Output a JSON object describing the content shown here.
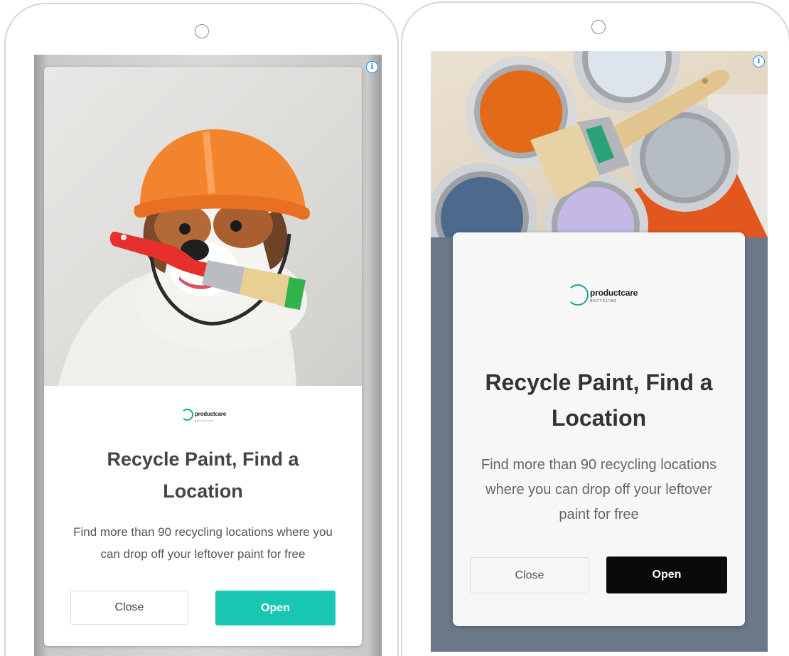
{
  "ads": [
    {
      "title": "Recycle Paint, Find a Location",
      "description": "Find more than 90 recycling locations where you can drop off your leftover paint for free",
      "logo": {
        "brand": "productcare",
        "sub": "RECYCLING"
      },
      "close_label": "Close",
      "open_label": "Open",
      "info_glyph": "i",
      "hero_image": "dog-hard-hat-paintbrush",
      "accent_color": "#19c6b3"
    },
    {
      "title": "Recycle Paint, Find a Location",
      "description": "Find more than 90 recycling locations where you can drop off your leftover paint for free",
      "logo": {
        "brand": "productcare",
        "sub": "RECYCLING"
      },
      "close_label": "Close",
      "open_label": "Open",
      "info_glyph": "i",
      "hero_image": "open-paint-cans-with-brush",
      "accent_color": "#0a0a0a"
    }
  ]
}
